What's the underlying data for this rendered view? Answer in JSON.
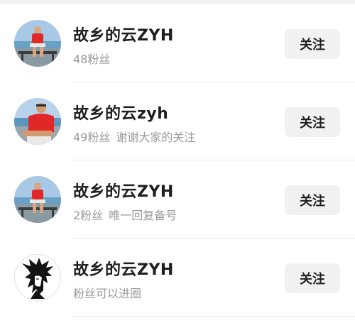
{
  "users": [
    {
      "name": "故乡的云ZYH",
      "followers": "48粉丝",
      "bio": "",
      "follow_label": "关注",
      "avatar_icon": "beach-photo-avatar"
    },
    {
      "name": "故乡的云zyh",
      "followers": "49粉丝",
      "bio": "谢谢大家的关注",
      "follow_label": "关注",
      "avatar_icon": "beach-photo-avatar"
    },
    {
      "name": "故乡的云ZYH",
      "followers": "2粉丝",
      "bio": "唯一回复备号",
      "follow_label": "关注",
      "avatar_icon": "beach-photo-avatar"
    },
    {
      "name": "故乡的云ZYH",
      "followers": "",
      "bio": "粉丝可以进圈",
      "follow_label": "关注",
      "avatar_icon": "anime-sketch-avatar"
    }
  ],
  "colors": {
    "name_text": "#1f1f1f",
    "meta_text": "#9a9a9a",
    "button_bg": "#f1f1f1",
    "divider": "#e6e6e6"
  }
}
